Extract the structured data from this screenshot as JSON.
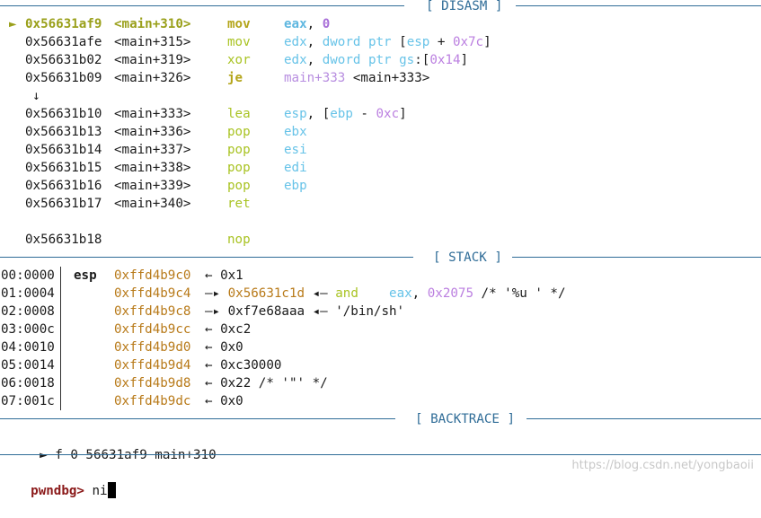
{
  "sections": {
    "disasm": "[ DISASM ]",
    "stack": "[ STACK ]",
    "backtrace": "[ BACKTRACE ]"
  },
  "disasm": {
    "current_marker": "►",
    "rows": [
      {
        "addr": "0x56631af9",
        "sym": "<main+310>",
        "mnemonic": "mov",
        "ops": [
          [
            "eax",
            "reg"
          ],
          [
            ", ",
            "punct"
          ],
          [
            "0",
            "num"
          ]
        ]
      },
      {
        "addr": "0x56631afe",
        "sym": "<main+315>",
        "mnemonic": "mov",
        "ops": [
          [
            "edx",
            "reg"
          ],
          [
            ", ",
            "punct"
          ],
          [
            "dword ptr",
            "kw"
          ],
          [
            " [",
            "punct"
          ],
          [
            "esp",
            "reg"
          ],
          [
            " + ",
            "punct"
          ],
          [
            "0x7c",
            "num"
          ],
          [
            "]",
            "punct"
          ]
        ]
      },
      {
        "addr": "0x56631b02",
        "sym": "<main+319>",
        "mnemonic": "xor",
        "ops": [
          [
            "edx",
            "reg"
          ],
          [
            ", ",
            "punct"
          ],
          [
            "dword ptr",
            "kw"
          ],
          [
            " ",
            "punct"
          ],
          [
            "gs",
            "reg"
          ],
          [
            ":[",
            "punct"
          ],
          [
            "0x14",
            "num"
          ],
          [
            "]",
            "punct"
          ]
        ]
      },
      {
        "addr": "0x56631b09",
        "sym": "<main+326>",
        "mnemonic": "je",
        "ops": [
          [
            "main+333",
            "sym"
          ],
          [
            " ",
            "punct"
          ],
          [
            "<main+333>",
            "text"
          ]
        ]
      },
      {
        "addr": "0x56631b10",
        "sym": "<main+333>",
        "mnemonic": "lea",
        "ops": [
          [
            "esp",
            "reg"
          ],
          [
            ", [",
            "punct"
          ],
          [
            "ebp",
            "reg"
          ],
          [
            " - ",
            "punct"
          ],
          [
            "0xc",
            "num"
          ],
          [
            "]",
            "punct"
          ]
        ]
      },
      {
        "addr": "0x56631b13",
        "sym": "<main+336>",
        "mnemonic": "pop",
        "ops": [
          [
            "ebx",
            "reg"
          ]
        ]
      },
      {
        "addr": "0x56631b14",
        "sym": "<main+337>",
        "mnemonic": "pop",
        "ops": [
          [
            "esi",
            "reg"
          ]
        ]
      },
      {
        "addr": "0x56631b15",
        "sym": "<main+338>",
        "mnemonic": "pop",
        "ops": [
          [
            "edi",
            "reg"
          ]
        ]
      },
      {
        "addr": "0x56631b16",
        "sym": "<main+339>",
        "mnemonic": "pop",
        "ops": [
          [
            "ebp",
            "reg"
          ]
        ]
      },
      {
        "addr": "0x56631b17",
        "sym": "<main+340>",
        "mnemonic": "ret",
        "ops": []
      },
      {
        "addr": "0x56631b18",
        "sym": "",
        "mnemonic": "nop",
        "ops": []
      }
    ],
    "branch_arrow": "↓"
  },
  "stack": {
    "rows": [
      {
        "idx": "00:0000",
        "reg": "esp",
        "addr": "0xffd4b9c0",
        "chain": [
          [
            "←",
            "text"
          ],
          [
            " 0x1",
            "text"
          ]
        ]
      },
      {
        "idx": "01:0004",
        "reg": "",
        "addr": "0xffd4b9c4",
        "chain": [
          [
            "—▸",
            "text"
          ],
          [
            " ",
            "text"
          ],
          [
            "0x56631c1d",
            "code"
          ],
          [
            " ◂— ",
            "text"
          ],
          [
            "and",
            "mn"
          ],
          [
            "    ",
            "text"
          ],
          [
            "eax",
            "reg"
          ],
          [
            ", ",
            "punct"
          ],
          [
            "0x2075",
            "num"
          ],
          [
            " /* '%u ' */",
            "text"
          ]
        ]
      },
      {
        "idx": "02:0008",
        "reg": "",
        "addr": "0xffd4b9c8",
        "chain": [
          [
            "—▸",
            "text"
          ],
          [
            " 0xf7e68aaa ◂— '/bin/sh'",
            "text"
          ]
        ]
      },
      {
        "idx": "03:000c",
        "reg": "",
        "addr": "0xffd4b9cc",
        "chain": [
          [
            "←",
            "text"
          ],
          [
            " 0xc2",
            "text"
          ]
        ]
      },
      {
        "idx": "04:0010",
        "reg": "",
        "addr": "0xffd4b9d0",
        "chain": [
          [
            "←",
            "text"
          ],
          [
            " 0x0",
            "text"
          ]
        ]
      },
      {
        "idx": "05:0014",
        "reg": "",
        "addr": "0xffd4b9d4",
        "chain": [
          [
            "←",
            "text"
          ],
          [
            " 0xc30000",
            "text"
          ]
        ]
      },
      {
        "idx": "06:0018",
        "reg": "",
        "addr": "0xffd4b9d8",
        "chain": [
          [
            "←",
            "text"
          ],
          [
            " 0x22 /* '\"' */",
            "text"
          ]
        ]
      },
      {
        "idx": "07:001c",
        "reg": "",
        "addr": "0xffd4b9dc",
        "chain": [
          [
            "←",
            "text"
          ],
          [
            " 0x0",
            "text"
          ]
        ]
      }
    ]
  },
  "backtrace": {
    "marker": "►",
    "text": "f 0 56631af9 main+310"
  },
  "prompt": {
    "label": "pwndbg>",
    "input": "ni"
  },
  "watermark": "https://blog.csdn.net/yongbaoii",
  "colors": {
    "separator": "#2f6c97",
    "register": "#67c3e8",
    "mnemonic": "#a9c323",
    "number": "#bb7fe0",
    "stack_addr": "#b87a19",
    "prompt": "#8b1a1a"
  }
}
